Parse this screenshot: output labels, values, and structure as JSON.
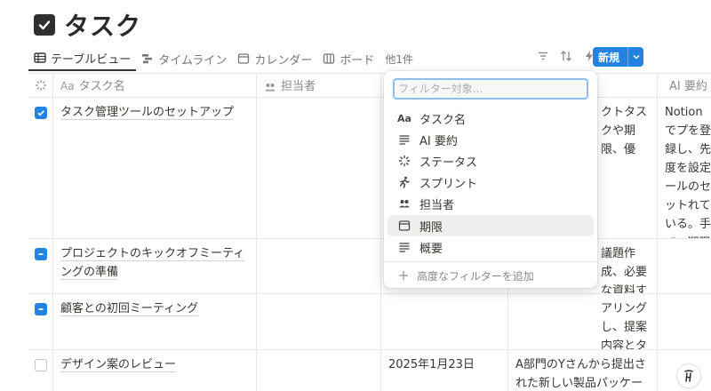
{
  "page": {
    "title": "タスク"
  },
  "views": {
    "tabs": [
      {
        "label": "テーブルビュー",
        "icon": "table-icon",
        "active": true
      },
      {
        "label": "タイムライン",
        "icon": "timeline-icon"
      },
      {
        "label": "カレンダー",
        "icon": "calendar-icon"
      },
      {
        "label": "ボード",
        "icon": "board-icon"
      }
    ],
    "more": "他1件"
  },
  "toolbar": {
    "icons": [
      "filter-icon",
      "sort-icon",
      "automation-icon",
      "search-icon",
      "more-icon"
    ],
    "new_label": "新規"
  },
  "table": {
    "headers": {
      "name": "タスク名",
      "name_prefix": "Aa",
      "assignee": "担当者",
      "ai_summary": "AI 要約"
    },
    "rows": [
      {
        "status": "checked",
        "name": "タスク管理ツールのセットアップ",
        "date": "",
        "summary": "クトタスクや期限、優",
        "ai": "Notionでプを登録し、先度を設定ールのセットれている。手で、期限日。"
      },
      {
        "status": "partial",
        "name": "プロジェクトのキックオフミーティングの準備",
        "date": "",
        "summary": "議題作成、必要な資料する。",
        "ai": ""
      },
      {
        "status": "partial",
        "name": "顧客との初回ミーティング",
        "date": "",
        "summary": "アリングし、提案内容とタイムラインをまとめる。",
        "ai": ""
      },
      {
        "status": "empty",
        "name": "デザイン案のレビュー",
        "date": "2025年1月23日",
        "summary": "A部門のYさんから提出された新しい製品パッケージのデザイン案を、マーケティング",
        "ai": ""
      }
    ]
  },
  "filter_popup": {
    "placeholder": "フィルター対象...",
    "options": [
      {
        "label": "タスク名",
        "icon": "text-property-icon",
        "glyph": "Aa"
      },
      {
        "label": "AI 要約",
        "icon": "lines-icon"
      },
      {
        "label": "ステータス",
        "icon": "status-icon"
      },
      {
        "label": "スプリント",
        "icon": "runner-icon"
      },
      {
        "label": "担当者",
        "icon": "people-icon"
      },
      {
        "label": "期限",
        "icon": "calendar-icon",
        "hover": true
      },
      {
        "label": "概要",
        "icon": "lines-icon"
      }
    ],
    "advanced": "高度なフィルターを追加"
  },
  "colors": {
    "accent": "#2383e2",
    "hover": "#efefed"
  }
}
